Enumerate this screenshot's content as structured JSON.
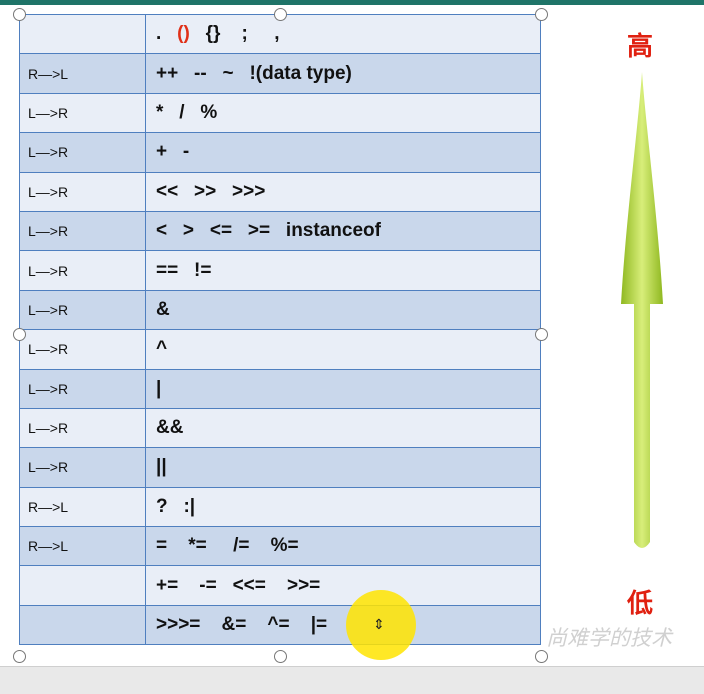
{
  "rows": [
    {
      "assoc": "",
      "ops": [
        {
          "text": ".   "
        },
        {
          "text": "()",
          "red": true
        },
        {
          "text": "   {}    ;     ,"
        }
      ]
    },
    {
      "assoc": "R—>L",
      "ops": [
        {
          "text": "++   --   ~   !(data type)"
        }
      ]
    },
    {
      "assoc": "L—>R",
      "ops": [
        {
          "text": "*   /   %"
        }
      ]
    },
    {
      "assoc": "L—>R",
      "ops": [
        {
          "text": "+   -"
        }
      ]
    },
    {
      "assoc": "L—>R",
      "ops": [
        {
          "text": "<<   >>   >>>"
        }
      ]
    },
    {
      "assoc": "L—>R",
      "ops": [
        {
          "text": "<   >   <=   >=   instanceof"
        }
      ]
    },
    {
      "assoc": "L—>R",
      "ops": [
        {
          "text": "==   !="
        }
      ]
    },
    {
      "assoc": "L—>R",
      "ops": [
        {
          "text": "&"
        }
      ]
    },
    {
      "assoc": "L—>R",
      "ops": [
        {
          "text": "^"
        }
      ]
    },
    {
      "assoc": "L—>R",
      "ops": [
        {
          "text": "|"
        }
      ]
    },
    {
      "assoc": "L—>R",
      "ops": [
        {
          "text": "&&"
        }
      ]
    },
    {
      "assoc": "L—>R",
      "ops": [
        {
          "text": "||"
        }
      ]
    },
    {
      "assoc": "R—>L",
      "ops": [
        {
          "text": "?   :|"
        }
      ]
    },
    {
      "assoc": "R—>L",
      "ops": [
        {
          "text": "=    *=     /=    %="
        }
      ]
    },
    {
      "assoc": "",
      "ops": [
        {
          "text": "+=    -=   <<=    >>="
        }
      ]
    },
    {
      "assoc": "",
      "ops": [
        {
          "text": ">>>=    &=    ^=    |="
        }
      ]
    }
  ],
  "labels": {
    "high": "高",
    "low": "低"
  },
  "watermark": "尚难学的技术",
  "colors": {
    "row_even": "#c9d7eb",
    "row_odd": "#e9eef7",
    "arrow": "#a6cc2e",
    "label": "#e02010"
  },
  "cursor_icon": "resize-vertical-icon"
}
